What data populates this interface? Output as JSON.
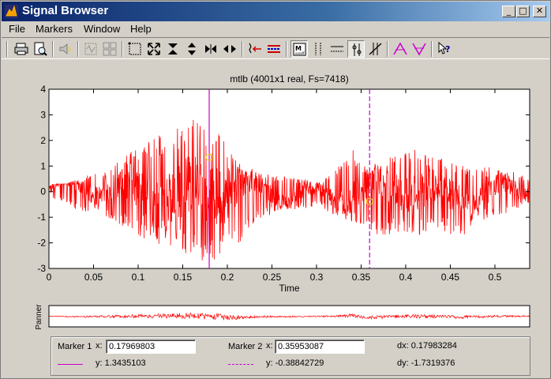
{
  "window": {
    "title": "Signal Browser",
    "controls": {
      "minimize": "_",
      "maximize": "□",
      "close": "✕"
    }
  },
  "menu": [
    "File",
    "Markers",
    "Window",
    "Help"
  ],
  "toolbar": {
    "icons": [
      "print-icon",
      "print-preview-icon",
      "speaker-icon",
      "select-signal-icon",
      "array-signal-icon",
      "zoom-box-icon",
      "zoom-xy-icon",
      "zoom-x-icon",
      "zoom-y-icon",
      "full-view-x-icon",
      "full-view-y-icon",
      "set-link-icon",
      "panner-icon",
      "markers-toggle-icon",
      "vertical-markers-icon",
      "horizontal-markers-icon",
      "track-markers-icon",
      "slope-markers-icon",
      "peak-markers-icon",
      "valley-markers-icon",
      "whats-this-icon"
    ]
  },
  "colors": {
    "signal": "#ff0000",
    "marker1": "#cc00cc",
    "marker2": "#cc00cc",
    "titlebar": "#0a246a"
  },
  "chart_data": {
    "type": "line",
    "title": "mtlb (4001x1 real, Fs=7418)",
    "xlabel": "Time",
    "ylabel": "",
    "xlim": [
      0,
      0.539
    ],
    "ylim": [
      -3,
      4
    ],
    "xticks": [
      "0",
      "0.05",
      "0.1",
      "0.15",
      "0.2",
      "0.25",
      "0.3",
      "0.35",
      "0.4",
      "0.45",
      "0.5"
    ],
    "yticks": [
      "4",
      "3",
      "2",
      "1",
      "0",
      "-1",
      "-2",
      "-3"
    ],
    "grid": false,
    "series": [
      {
        "envelope_time": [
          0,
          0.02,
          0.04,
          0.06,
          0.08,
          0.1,
          0.12,
          0.14,
          0.16,
          0.17,
          0.18,
          0.19,
          0.2,
          0.21,
          0.22,
          0.24,
          0.26,
          0.28,
          0.3,
          0.32,
          0.33,
          0.34,
          0.35,
          0.36,
          0.38,
          0.4,
          0.41,
          0.42,
          0.44,
          0.46,
          0.48,
          0.5,
          0.52,
          0.539
        ],
        "envelope_max": [
          0.3,
          0.3,
          0.6,
          0.8,
          1.2,
          1.8,
          2.2,
          2.4,
          3.0,
          2.8,
          2.2,
          2.6,
          1.8,
          1.4,
          1.0,
          0.7,
          0.6,
          0.5,
          0.5,
          0.8,
          1.2,
          1.7,
          1.2,
          1.0,
          1.3,
          1.6,
          1.8,
          1.5,
          1.3,
          1.1,
          0.9,
          1.0,
          0.8,
          0.5
        ],
        "envelope_min": [
          -0.2,
          -0.5,
          -0.9,
          -0.9,
          -1.3,
          -1.8,
          -2.0,
          -2.3,
          -2.5,
          -2.7,
          -2.6,
          -2.7,
          -2.8,
          -2.4,
          -1.6,
          -1.0,
          -0.8,
          -0.7,
          -0.6,
          -0.9,
          -1.0,
          -1.3,
          -1.7,
          -1.8,
          -1.7,
          -1.6,
          -1.8,
          -1.7,
          -1.5,
          -1.9,
          -1.2,
          -1.0,
          -0.8,
          -0.6
        ]
      }
    ],
    "panner_label": "Panner"
  },
  "markers": {
    "m1": {
      "label": "Marker 1",
      "x_label": "x:",
      "x": "0.17969803",
      "y_text": "y: 1.3435103",
      "x_value": 0.17969803,
      "y_value": 1.3435103
    },
    "m2": {
      "label": "Marker 2",
      "x_label": "x:",
      "x": "0.35953087",
      "y_text": "y: -0.38842729",
      "x_value": 0.35953087,
      "y_value": -0.38842729
    },
    "dx": "dx: 0.17983284",
    "dy": "dy: -1.7319376"
  }
}
